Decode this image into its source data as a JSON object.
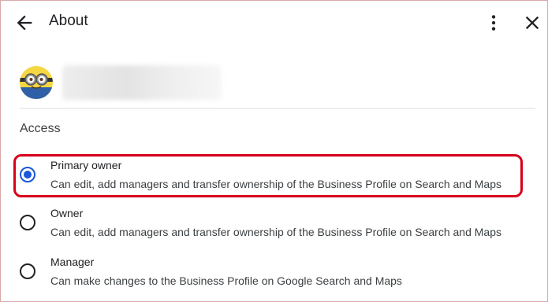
{
  "header": {
    "title": "About",
    "back_icon": "arrow-back-icon",
    "more_icon": "more-vert-icon",
    "close_icon": "close-icon"
  },
  "profile": {
    "avatar": "minion-avatar"
  },
  "access": {
    "section_title": "Access",
    "options": [
      {
        "title": "Primary owner",
        "description": "Can edit, add managers and transfer ownership of the Business Profile on Search and Maps",
        "selected": true
      },
      {
        "title": "Owner",
        "description": "Can edit, add managers and transfer ownership of the Business Profile on Search and Maps",
        "selected": false
      },
      {
        "title": "Manager",
        "description": "Can make changes to the Business Profile on Google Search and Maps",
        "selected": false
      }
    ]
  },
  "colors": {
    "radio_selected": "#1a56db",
    "highlight_border": "#d6001c"
  }
}
